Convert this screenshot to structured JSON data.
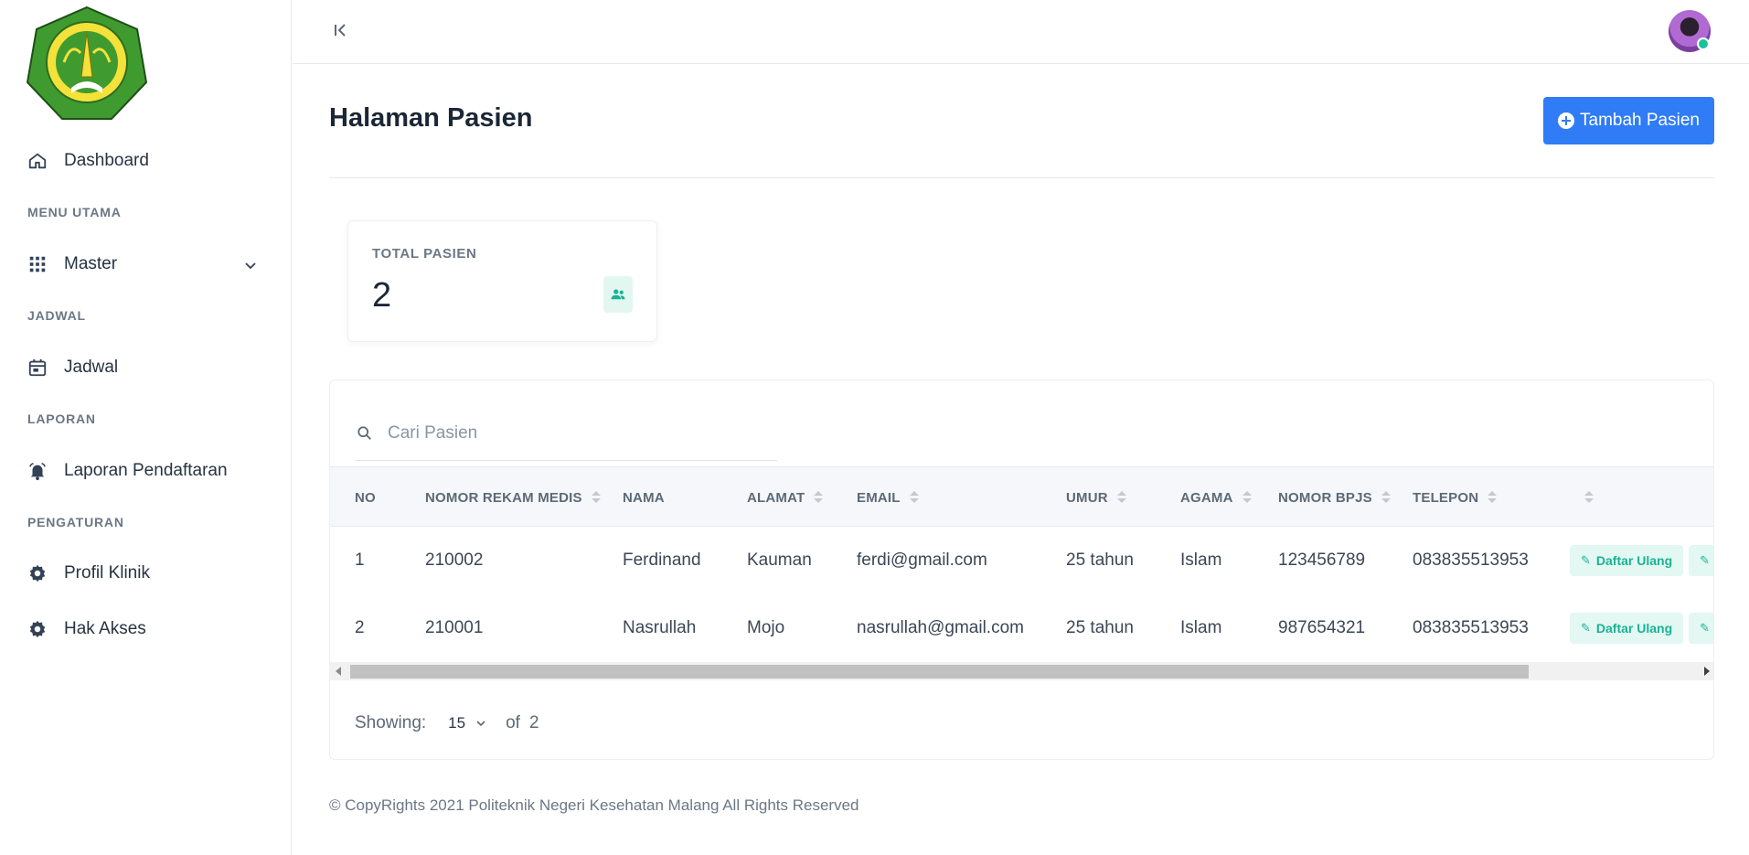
{
  "sidebar": {
    "logo_text": "POLITEKNIK KESEHATAN KEMENKES MALANG",
    "dashboard": "Dashboard",
    "sections": {
      "menu_utama": "MENU UTAMA",
      "jadwal": "JADWAL",
      "laporan": "LAPORAN",
      "pengaturan": "PENGATURAN"
    },
    "master": "Master",
    "jadwal_item": "Jadwal",
    "laporan_item": "Laporan Pendaftaran",
    "profil_klinik": "Profil Klinik",
    "hak_akses": "Hak Akses"
  },
  "header": {
    "page_title": "Halaman Pasien",
    "add_button": "Tambah Pasien"
  },
  "stats": {
    "label": "TOTAL PASIEN",
    "value": "2"
  },
  "search": {
    "placeholder": "Cari Pasien"
  },
  "table": {
    "columns": [
      "NO",
      "NOMOR REKAM MEDIS",
      "NAMA",
      "ALAMAT",
      "EMAIL",
      "UMUR",
      "AGAMA",
      "NOMOR BPJS",
      "TELEPON"
    ],
    "rows": [
      {
        "no": "1",
        "rm": "210002",
        "nama": "Ferdinand",
        "alamat": "Kauman",
        "email": "ferdi@gmail.com",
        "umur": "25 tahun",
        "agama": "Islam",
        "bpjs": "123456789",
        "telepon": "083835513953",
        "action1": "Daftar Ulang",
        "action2": "E"
      },
      {
        "no": "2",
        "rm": "210001",
        "nama": "Nasrullah",
        "alamat": "Mojo",
        "email": "nasrullah@gmail.com",
        "umur": "25 tahun",
        "agama": "Islam",
        "bpjs": "987654321",
        "telepon": "083835513953",
        "action1": "Daftar Ulang",
        "action2": "E"
      }
    ]
  },
  "pager": {
    "showing_label": "Showing:",
    "per_page": "15",
    "of_label": "of",
    "total": "2"
  },
  "footer": {
    "text": "© CopyRights 2021 Politeknik Negeri Kesehatan Malang All Rights Reserved"
  },
  "colors": {
    "primary": "#2f7cf6",
    "accent_green": "#19b394",
    "logo_green": "#3f9b2f",
    "logo_yellow": "#f2d21b"
  }
}
